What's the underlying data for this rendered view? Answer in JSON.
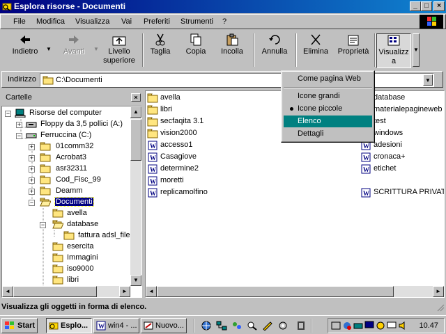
{
  "window": {
    "title": "Esplora risorse - Documenti",
    "caption_buttons": {
      "minimize": "_",
      "maximize": "□",
      "close": "×"
    }
  },
  "menu": [
    "File",
    "Modifica",
    "Visualizza",
    "Vai",
    "Preferiti",
    "Strumenti",
    "?"
  ],
  "toolbar": {
    "back": "Indietro",
    "forward": "Avanti",
    "up_line1": "Livello",
    "up_line2": "superiore",
    "cut": "Taglia",
    "copy": "Copia",
    "paste": "Incolla",
    "undo": "Annulla",
    "delete": "Elimina",
    "properties": "Proprietà",
    "views_line1": "Visualizz",
    "views_line2": "a"
  },
  "address": {
    "label": "Indirizzo",
    "value": "C:\\Documenti"
  },
  "tree": {
    "header": "Cartelle",
    "close": "×",
    "nodes": [
      {
        "label": "Risorse del computer"
      },
      {
        "label": "Floppy da 3,5 pollici (A:)"
      },
      {
        "label": "Ferruccina (C:)"
      },
      {
        "label": "01comm32"
      },
      {
        "label": "Acrobat3"
      },
      {
        "label": "asr32311"
      },
      {
        "label": "Cod_Fisc_99"
      },
      {
        "label": "Deamm"
      },
      {
        "label": "Documenti"
      },
      {
        "label": "avella"
      },
      {
        "label": "database"
      },
      {
        "label": "fattura adsl_file"
      },
      {
        "label": "esercita"
      },
      {
        "label": "Immagini"
      },
      {
        "label": "iso9000"
      },
      {
        "label": "libri"
      }
    ]
  },
  "files": {
    "col1": [
      {
        "label": "avella",
        "icon": "folder-icon"
      },
      {
        "label": "libri",
        "icon": "folder-icon"
      },
      {
        "label": "secfaqita 3.1",
        "icon": "folder-icon"
      },
      {
        "label": "vision2000",
        "icon": "folder-icon"
      },
      {
        "label": "accesso1",
        "icon": "word-document-icon"
      },
      {
        "label": "Casagiove",
        "icon": "word-document-icon"
      },
      {
        "label": "determine2",
        "icon": "word-document-icon"
      },
      {
        "label": "moretti",
        "icon": "word-document-icon"
      },
      {
        "label": "replicamolfino",
        "icon": "word-document-icon"
      }
    ],
    "col2": [
      {
        "label": "database",
        "icon": "folder-icon"
      },
      {
        "label": "materialepagineweb",
        "icon": "folder-icon"
      },
      {
        "label": "test",
        "icon": "folder-icon"
      },
      {
        "label": "windows",
        "icon": "folder-icon"
      },
      {
        "label": "adesioni",
        "icon": "word-document-icon"
      },
      {
        "label": "cronaca+",
        "icon": "word-document-icon"
      },
      {
        "label": "etichet",
        "icon": "word-document-icon"
      },
      {
        "label": "",
        "icon": ""
      },
      {
        "label": "SCRITTURA PRIVATA",
        "icon": "word-document-icon"
      }
    ]
  },
  "view_menu": {
    "web": "Come pagina Web",
    "large": "Icone grandi",
    "small": "Icone piccole",
    "list": "Elenco",
    "details": "Dettagli"
  },
  "status": "Visualizza gli oggetti in forma di elenco.",
  "taskbar": {
    "start": "Start",
    "tasks": [
      "Esplo...",
      "win4 - ...",
      "Nuovo..."
    ],
    "clock": "10.47"
  },
  "colors": {
    "title_start": "#000080",
    "title_end": "#1084d0",
    "highlight": "#008080",
    "selection": "#000080"
  }
}
